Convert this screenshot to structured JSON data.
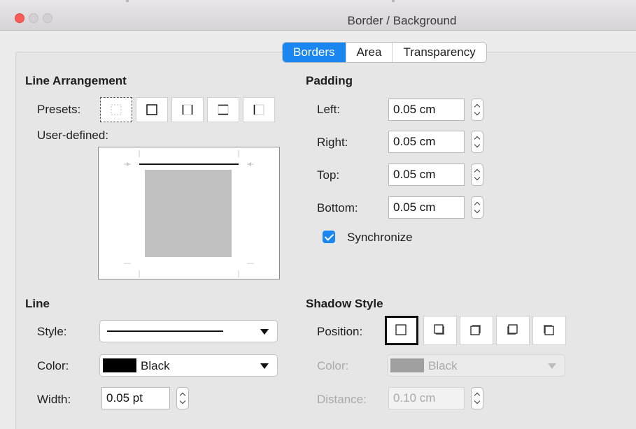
{
  "window": {
    "title": "Border / Background"
  },
  "tabs": [
    {
      "label": "Borders",
      "active": true
    },
    {
      "label": "Area",
      "active": false
    },
    {
      "label": "Transparency",
      "active": false
    }
  ],
  "line_arrangement": {
    "heading": "Line Arrangement",
    "presets_label": "Presets:",
    "presets": [
      "preset-none-icon",
      "preset-box-icon",
      "preset-left-right-icon",
      "preset-top-bottom-icon",
      "preset-left-only-icon"
    ],
    "user_defined_label": "User-defined:"
  },
  "padding": {
    "heading": "Padding",
    "left_label": "Left:",
    "left_value": "0.05 cm",
    "right_label": "Right:",
    "right_value": "0.05 cm",
    "top_label": "Top:",
    "top_value": "0.05 cm",
    "bottom_label": "Bottom:",
    "bottom_value": "0.05 cm",
    "synchronize_label": "Synchronize",
    "synchronize_checked": true
  },
  "line": {
    "heading": "Line",
    "style_label": "Style:",
    "color_label": "Color:",
    "color_value": "Black",
    "color_swatch": "#000000",
    "width_label": "Width:",
    "width_value": "0.05 pt"
  },
  "shadow_style": {
    "heading": "Shadow Style",
    "position_label": "Position:",
    "positions": [
      "shadow-none-icon",
      "shadow-bottom-right-icon",
      "shadow-top-right-icon",
      "shadow-bottom-left-icon",
      "shadow-top-left-icon"
    ],
    "color_label": "Color:",
    "color_value": "Black",
    "color_swatch": "#a0a0a0",
    "distance_label": "Distance:",
    "distance_value": "0.10 cm"
  },
  "colors": {
    "accent": "#1a86f0",
    "close": "#fc5c57"
  }
}
